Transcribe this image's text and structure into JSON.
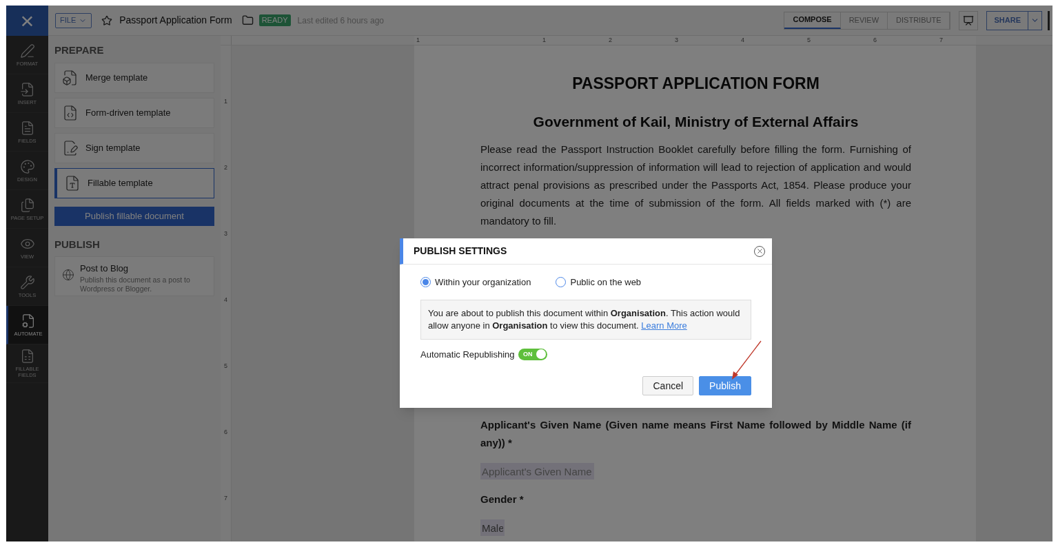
{
  "app": {
    "close_label": "×"
  },
  "toolbar": {
    "file_menu": "FILE",
    "title": "Passport Application Form",
    "status": "READY",
    "last_edited": "Last edited 6 hours ago",
    "tabs": [
      {
        "label": "COMPOSE",
        "selected": true
      },
      {
        "label": "REVIEW",
        "selected": false
      },
      {
        "label": "DISTRIBUTE",
        "selected": false
      }
    ],
    "share": "SHARE"
  },
  "rail": [
    {
      "label": "FORMAT",
      "selected": false
    },
    {
      "label": "INSERT",
      "selected": false
    },
    {
      "label": "FIELDS",
      "selected": false
    },
    {
      "label": "DESIGN",
      "selected": false
    },
    {
      "label": "PAGE SETUP",
      "selected": false
    },
    {
      "label": "VIEW",
      "selected": false
    },
    {
      "label": "TOOLS",
      "selected": false
    },
    {
      "label": "AUTOMATE",
      "selected": true
    },
    {
      "label": "FILLABLE FIELDS",
      "selected": false
    }
  ],
  "panel": {
    "prepare_heading": "PREPARE",
    "templates": [
      {
        "label": "Merge template",
        "selected": false
      },
      {
        "label": "Form-driven template",
        "selected": false
      },
      {
        "label": "Sign template",
        "selected": false
      },
      {
        "label": "Fillable template",
        "selected": true
      }
    ],
    "publish_button": "Publish fillable document",
    "publish_heading": "PUBLISH",
    "blog": {
      "title": "Post to Blog",
      "description": "Publish this document as a post to Wordpress or Blogger."
    }
  },
  "ruler": {
    "horizontal": [
      "1",
      "1",
      "2",
      "3",
      "4",
      "5",
      "6",
      "7"
    ],
    "vertical": [
      "1",
      "2",
      "3",
      "4",
      "5",
      "6",
      "7"
    ]
  },
  "document": {
    "title": "PASSPORT APPLICATION FORM",
    "subtitle": "Government of Kail, Ministry of External Affairs",
    "intro": "Please read the Passport Instruction Booklet carefully before filling the form. Furnishing of incorrect information/suppression of information will lead to rejection of application and would attract penal provisions as prescribed under the Passports Act, 1854. Please produce your original documents at the time of submission of the form. All fields marked with (*) are mandatory to fill.",
    "fields": [
      {
        "label": "Applicant's Given Name (Given name means First Name followed by Middle Name (if any)) *",
        "placeholder": "Applicant's Given Name"
      },
      {
        "label": "Gender *",
        "value": "Male"
      }
    ]
  },
  "dialog": {
    "title": "PUBLISH SETTINGS",
    "options": [
      {
        "label": "Within your organization",
        "selected": true
      },
      {
        "label": "Public on the web",
        "selected": false
      }
    ],
    "notice": "You are about to publish this document within **Organisation**. This action would allow anyone in **Organisation** to view this document.",
    "notice_link": "Learn More",
    "toggle": {
      "label": "Automatic Republishing",
      "on": true,
      "text": "ON"
    },
    "buttons": [
      {
        "label": "Cancel",
        "kind": "secondary"
      },
      {
        "label": "Publish",
        "kind": "primary"
      }
    ]
  }
}
